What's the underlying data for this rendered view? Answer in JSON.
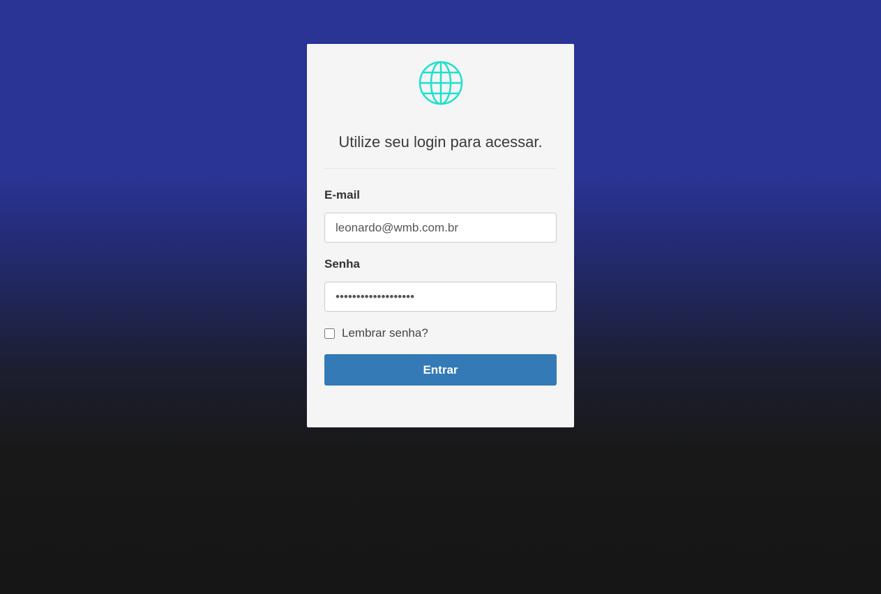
{
  "login": {
    "logo_icon": "globe-icon",
    "tagline": "Utilize seu login para acessar.",
    "email": {
      "label": "E-mail",
      "value": "leonardo@wmb.com.br"
    },
    "password": {
      "label": "Senha",
      "value": "•••••••••••••••••••"
    },
    "remember_label": "Lembrar senha?",
    "remember_checked": false,
    "submit_label": "Entrar"
  },
  "colors": {
    "accent": "#337ab7",
    "logo": "#1ee0cf",
    "background_top": "#2a3494",
    "background_bottom": "#161616",
    "card": "#f5f5f5"
  }
}
